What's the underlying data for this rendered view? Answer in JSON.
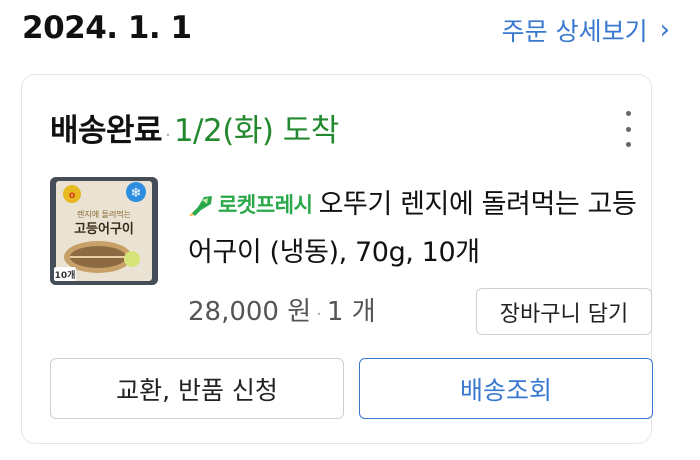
{
  "order": {
    "date": "2024. 1. 1",
    "detail_link": "주문 상세보기"
  },
  "shipment": {
    "status": "배송완료",
    "arrival": "1/2(화) 도착"
  },
  "product": {
    "badge_label": "로켓프레시",
    "title": "오뚜기 렌지에 돌려먹는 고등어구이 (냉동), 70g, 10개",
    "price": "28,000 원",
    "quantity": "1 개",
    "thumbnail": {
      "brand": "OTTOGI",
      "caption_top": "렌지에 돌려먹는",
      "caption_main": "고등어구이",
      "frozen_tag": "냉동",
      "count_tag": "10개"
    }
  },
  "actions": {
    "add_to_cart": "장바구니 담기",
    "exchange_return": "교환, 반품 신청",
    "track_delivery": "배송조회"
  },
  "colors": {
    "link_blue": "#3a78d0",
    "arrival_green": "#23892f",
    "rocket_green": "#2aa84a"
  }
}
